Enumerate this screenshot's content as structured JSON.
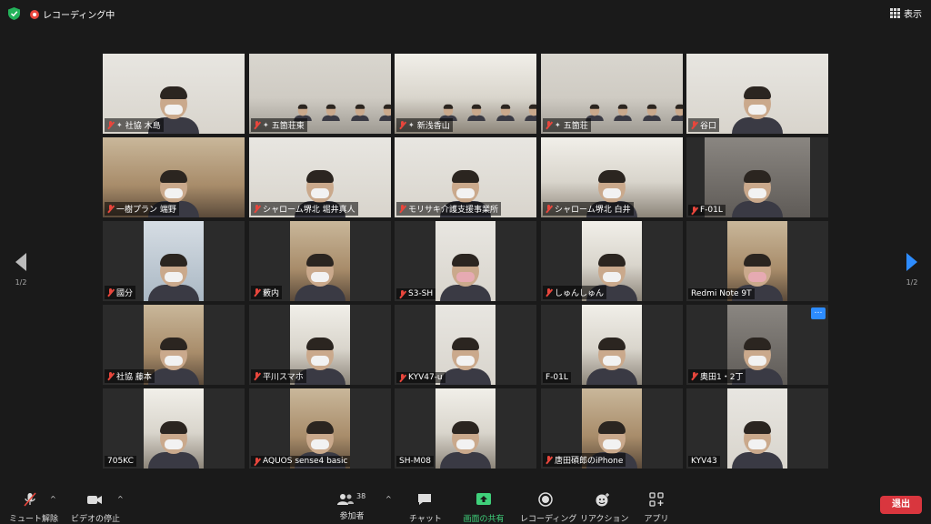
{
  "topbar": {
    "recording_label": "レコーディング中",
    "view_label": "表示"
  },
  "pager": {
    "left_page": "1/2",
    "right_page": "1/2"
  },
  "tiles": [
    {
      "name": "社協 木島",
      "muted": true,
      "pinned": true
    },
    {
      "name": "五箇荘東",
      "muted": true,
      "pinned": true
    },
    {
      "name": "新浅香山",
      "muted": true,
      "pinned": true
    },
    {
      "name": "五箇荘",
      "muted": true,
      "pinned": true
    },
    {
      "name": "谷口",
      "muted": true,
      "pinned": false,
      "active": true
    },
    {
      "name": "一樹プラン 端野",
      "muted": true,
      "pinned": false
    },
    {
      "name": "シャローム堺北 堀井真人",
      "muted": true,
      "pinned": false
    },
    {
      "name": "モリサキ介護支援事業所",
      "muted": true,
      "pinned": false
    },
    {
      "name": "シャローム堺北 白井",
      "muted": true,
      "pinned": false
    },
    {
      "name": "F-01L",
      "muted": true,
      "pinned": false
    },
    {
      "name": "國分",
      "muted": true,
      "pinned": false
    },
    {
      "name": "藪内",
      "muted": true,
      "pinned": false
    },
    {
      "name": "S3-SH",
      "muted": true,
      "pinned": false
    },
    {
      "name": "しゅんしゅん",
      "muted": true,
      "pinned": false
    },
    {
      "name": "Redmi Note 9T",
      "muted": false,
      "pinned": false
    },
    {
      "name": "社協 藤本",
      "muted": true,
      "pinned": false
    },
    {
      "name": "平川スマホ",
      "muted": true,
      "pinned": false
    },
    {
      "name": "KYV47-u",
      "muted": true,
      "pinned": false
    },
    {
      "name": "F-01L",
      "muted": false,
      "pinned": false
    },
    {
      "name": "奥田1・2丁",
      "muted": true,
      "pinned": false
    },
    {
      "name": "705KC",
      "muted": false,
      "pinned": false
    },
    {
      "name": "AQUOS sense4 basic",
      "muted": true,
      "pinned": false
    },
    {
      "name": "SH-M08",
      "muted": false,
      "pinned": false
    },
    {
      "name": "唐田碩郎のiPhone",
      "muted": true,
      "pinned": false
    },
    {
      "name": "KYV43",
      "muted": false,
      "pinned": false
    }
  ],
  "toolbar": {
    "unmute": "ミュート解除",
    "stop_video": "ビデオの停止",
    "participants": "参加者",
    "participant_count": "38",
    "chat": "チャット",
    "share": "画面の共有",
    "record": "レコーディング",
    "reactions": "リアクション",
    "apps": "アプリ",
    "leave": "退出"
  },
  "colors": {
    "background": "#1a1a1a",
    "active_speaker": "#c9f36a",
    "accent_blue": "#2d8cff",
    "leave_red": "#d9363e",
    "share_green": "#3fd07a"
  }
}
